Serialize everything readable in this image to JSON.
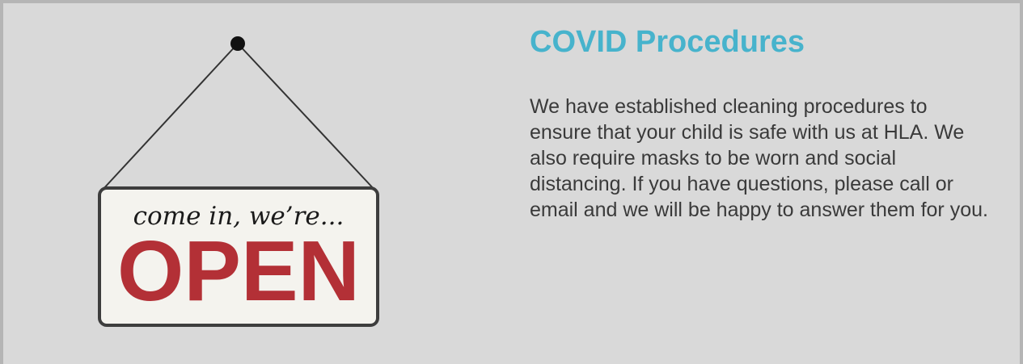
{
  "sign": {
    "tagline": "come in, we’re...",
    "word": "OPEN",
    "colors": {
      "board": "#f4f3ee",
      "border": "#3d3d3d",
      "open_red": "#b33036",
      "string": "#333333",
      "pin": "#111111"
    },
    "icons": [
      "pin-icon",
      "hanging-string"
    ]
  },
  "section": {
    "title": "COVID Procedures",
    "body": "We have established cleaning procedures to ensure that your child is safe with us at HLA. We also require masks to be worn and social distancing. If you have questions, please call or email and we will be happy to answer them for you."
  },
  "colors": {
    "background": "#d9d9d9",
    "title": "#47b3cc",
    "text": "#3a3a3a"
  }
}
